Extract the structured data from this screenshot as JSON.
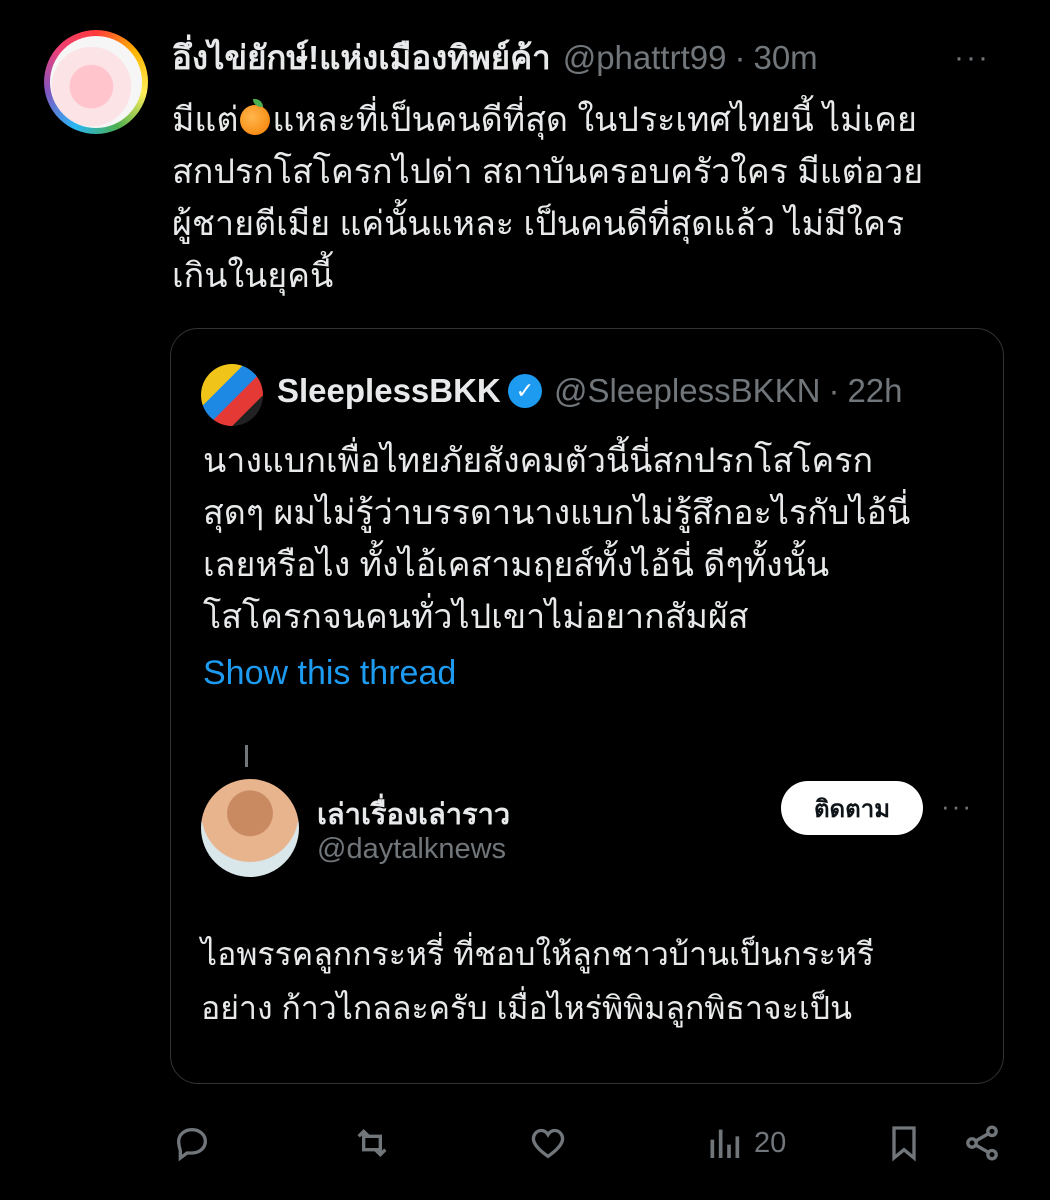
{
  "post": {
    "author_name": "อึ่งไข่ยักษ์!แห่งเมืองทิพย์ค้า",
    "handle": "@phattrt99",
    "separator": "·",
    "time": "30m",
    "more": "···",
    "text_before_emoji": "มีแต่",
    "emoji": "orange-emoji",
    "text_after_emoji": "แหละที่เป็นคนดีที่สุด ในประเทศไทยนี้ ไม่เคย\nสกปรกโสโครกไปด่า สถาบันครอบครัวใคร มีแต่อวย\nผู้ชายตีเมีย แค่นั้นแหละ เป็นคนดีที่สุดแล้ว ไม่มีใคร\nเกินในยุคนี้"
  },
  "quote": {
    "author_name": "SleeplessBKKN",
    "handle": "@SleeplessBKKN",
    "separator": "·",
    "time": "22h",
    "text": "นางแบกเพื่อไทยภัยสังคมตัวนี้นี่สกปรกโสโครก\nสุดๆ  ผมไม่รู้ว่าบรรดานางแบกไม่รู้สึกอะไรกับไอ้นี่\nเลยหรือไง ทั้งไอ้เคสามฤยส์ทั้งไอ้นี่ ดีๆทั้งนั้น\nโสโครกจนคนทั่วไปเขาไม่อยากสัมผัส",
    "show_thread": "Show this thread"
  },
  "embedded": {
    "author_name": "เล่าเรื่องเล่าราว",
    "handle": "@daytalknews",
    "follow_label": "ติดตาม",
    "more": "···",
    "text": "ไอพรรคลูกกระหรี่ ที่ชอบให้ลูกชาวบ้านเป็นกระหรี\nอย่าง ก้าวไกลละครับ เมื่อไหร่พิพิมลูกพิธาจะเป็น"
  },
  "actions": {
    "views_count": "20"
  },
  "colors": {
    "background": "#000000",
    "text": "#e7e9ea",
    "muted": "#71767b",
    "link": "#1d9bf0",
    "border": "#2f3336"
  }
}
